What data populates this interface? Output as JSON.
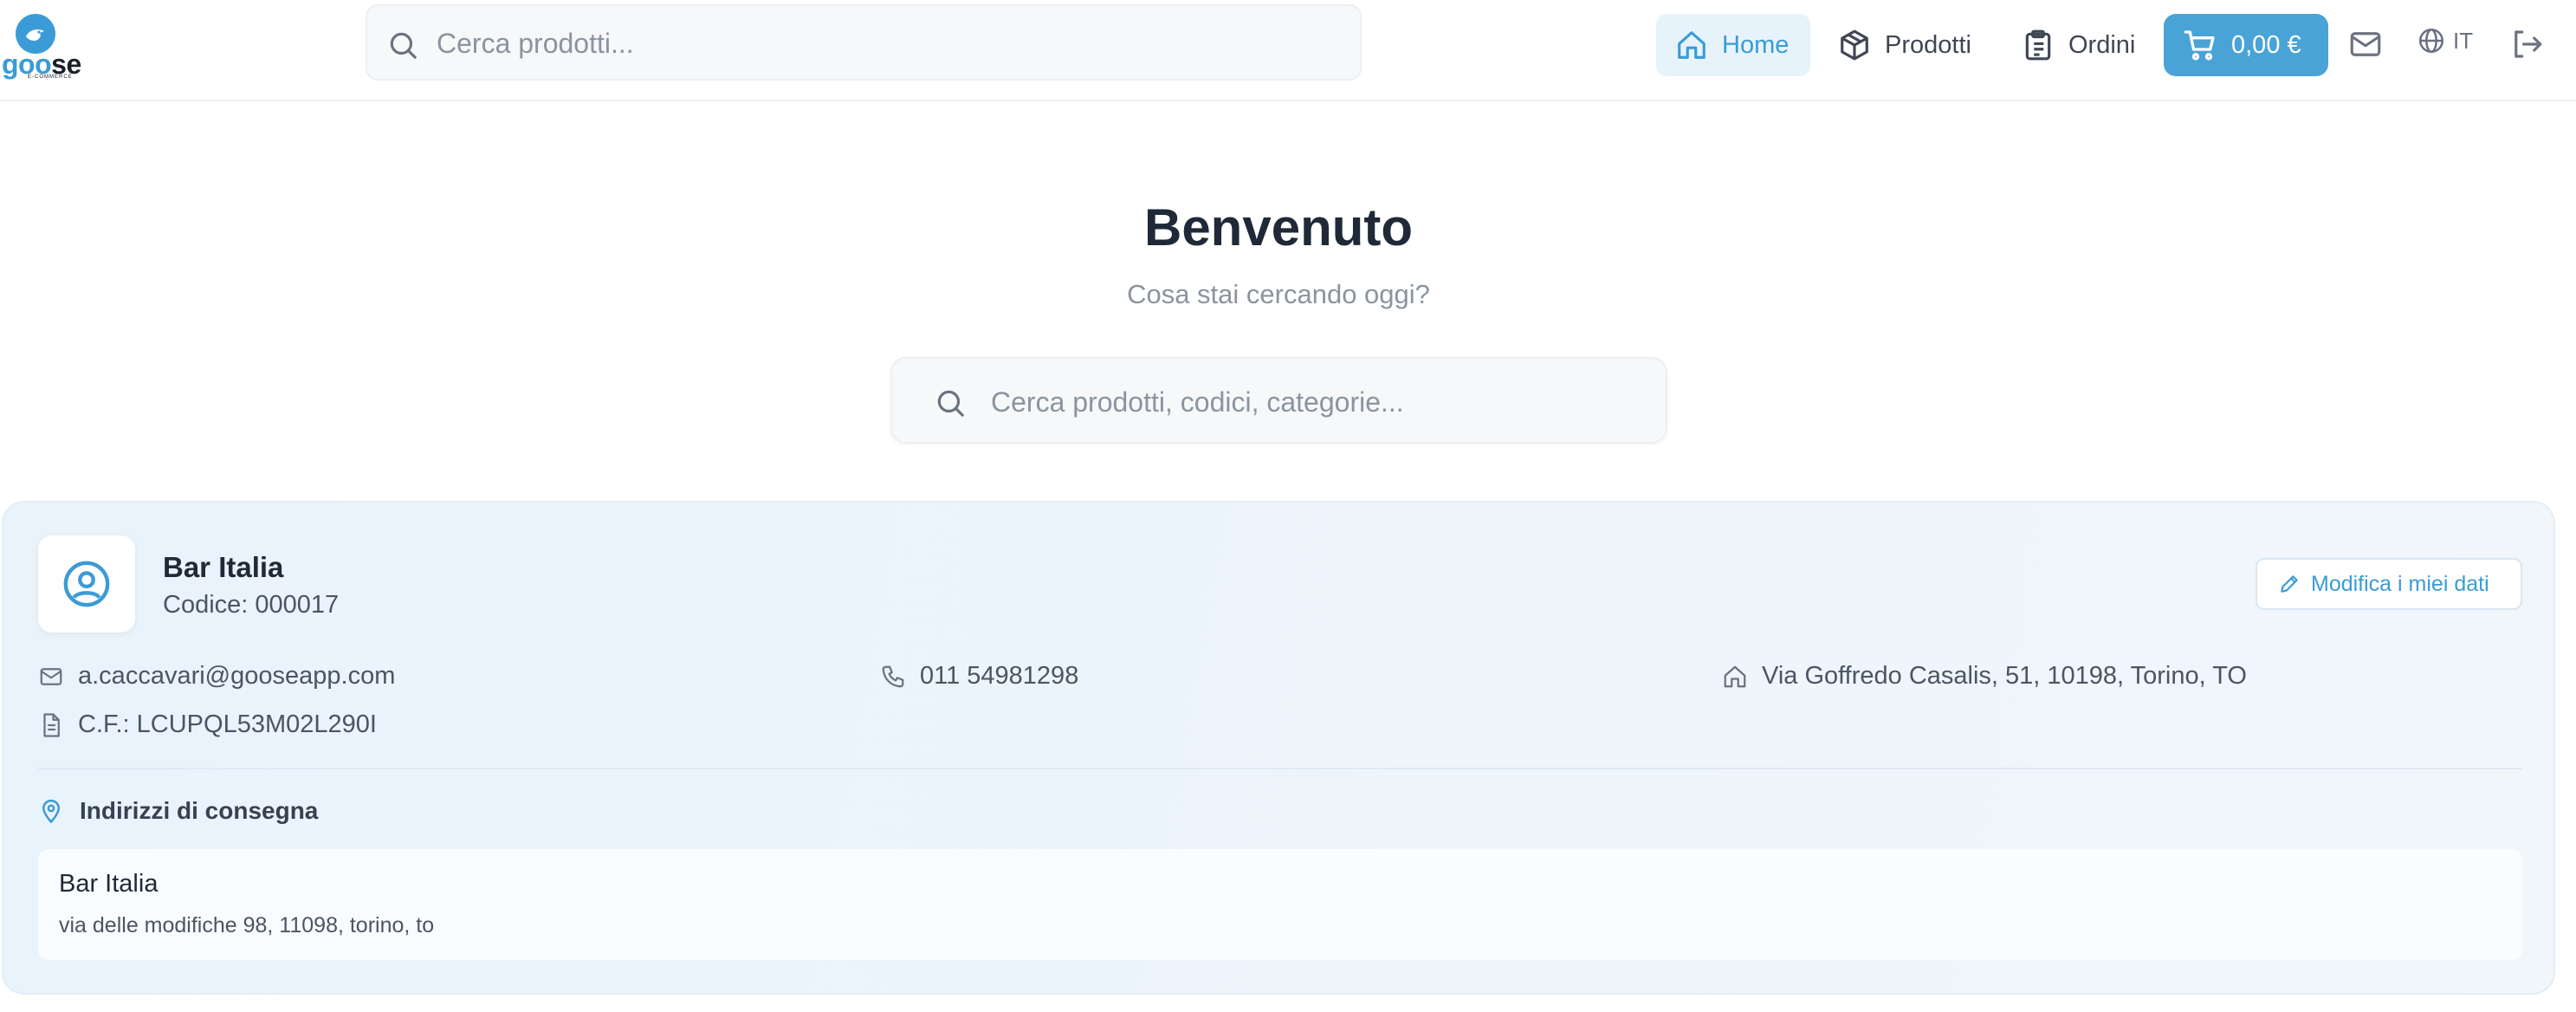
{
  "header": {
    "logo": {
      "wordmark_blue": "goo",
      "wordmark_dark": "se",
      "tagline": "E-COMMERCE"
    },
    "search": {
      "placeholder": "Cerca prodotti..."
    },
    "nav": {
      "home": "Home",
      "products": "Prodotti",
      "orders": "Ordini"
    },
    "cart": {
      "total": "0,00 €"
    },
    "language": "IT",
    "icons": {
      "search": "search-icon",
      "home": "home-icon",
      "products": "box-icon",
      "orders": "clipboard-icon",
      "cart": "cart-icon",
      "mail": "mail-icon",
      "language": "globe-icon",
      "logout": "logout-icon"
    }
  },
  "hero": {
    "title": "Benvenuto",
    "subtitle": "Cosa stai cercando oggi?",
    "search_placeholder": "Cerca prodotti, codici, categorie..."
  },
  "profile": {
    "name": "Bar Italia",
    "code": "Codice: 000017",
    "edit_label": "Modifica i miei dati",
    "email": "a.caccavari@gooseapp.com",
    "phone": "011 54981298",
    "address": "Via Goffredo Casalis, 51, 10198, Torino, TO",
    "tax_code": "C.F.: LCUPQL53M02L290I",
    "delivery": {
      "title": "Indirizzi di consegna",
      "items": [
        {
          "name": "Bar Italia",
          "address": "via delle modifiche 98, 11098, torino, to"
        }
      ]
    }
  },
  "colors": {
    "accent": "#3b9bd6",
    "cart_button": "#4aa3d6",
    "nav_active_bg": "#e7f3fb",
    "card_bg": "#eaf4fc",
    "text_dark": "#1f2937",
    "text_muted": "#8b949e"
  }
}
